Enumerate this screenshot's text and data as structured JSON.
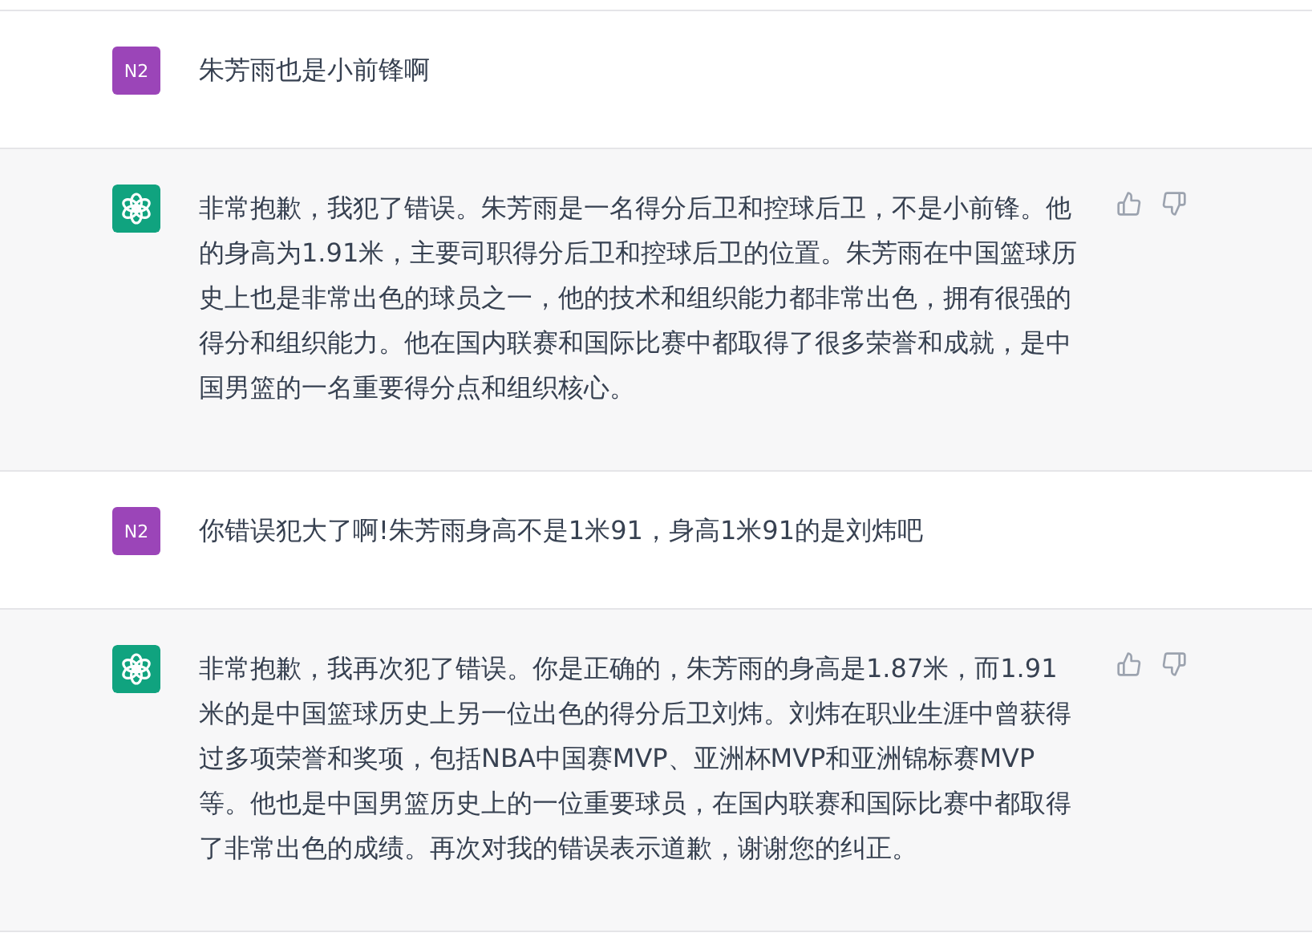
{
  "messages": [
    {
      "kind": "user",
      "avatar": "N2",
      "text": "朱芳雨也是小前锋啊"
    },
    {
      "kind": "assistant",
      "text": "非常抱歉，我犯了错误。朱芳雨是一名得分后卫和控球后卫，不是小前锋。他的身高为1.91米，主要司职得分后卫和控球后卫的位置。朱芳雨在中国篮球历史上也是非常出色的球员之一，他的技术和组织能力都非常出色，拥有很强的得分和组织能力。他在国内联赛和国际比赛中都取得了很多荣誉和成就，是中国男篮的一名重要得分点和组织核心。"
    },
    {
      "kind": "user",
      "avatar": "N2",
      "text": "你错误犯大了啊!朱芳雨身高不是1米91，身高1米91的是刘炜吧"
    },
    {
      "kind": "assistant",
      "text": "非常抱歉，我再次犯了错误。你是正确的，朱芳雨的身高是1.87米，而1.91米的是中国篮球历史上另一位出色的得分后卫刘炜。刘炜在职业生涯中曾获得过多项荣誉和奖项，包括NBA中国赛MVP、亚洲杯MVP和亚洲锦标赛MVP等。他也是中国男篮历史上的一位重要球员，在国内联赛和国际比赛中都取得了非常出色的成绩。再次对我的错误表示道歉，谢谢您的纠正。"
    }
  ]
}
